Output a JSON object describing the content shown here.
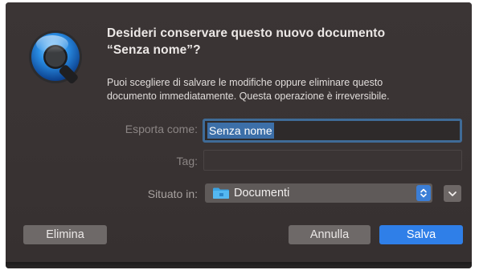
{
  "dialog": {
    "title_line1": "Desideri conservare questo nuovo documento",
    "title_line2": "“Senza nome”?",
    "message_line1": "Puoi scegliere di salvare le modifiche oppure eliminare questo",
    "message_line2": "documento immediatamente. Questa operazione è irreversibile."
  },
  "form": {
    "export_label": "Esporta come:",
    "export_value": "Senza nome",
    "tag_label": "Tag:",
    "tag_value": "",
    "location_label": "Situato in:",
    "location_value": "Documenti"
  },
  "buttons": {
    "delete_label": "Elimina",
    "cancel_label": "Annulla",
    "save_label": "Salva"
  },
  "icons": {
    "app": "quicktime-icon",
    "folder": "folder-icon",
    "stepper": "up-down-chevron-icon",
    "expand": "chevron-down-icon"
  },
  "colors": {
    "accent": "#2f7fe8",
    "dialog_bg": "#3a3434",
    "selection": "#3c6fa8"
  }
}
